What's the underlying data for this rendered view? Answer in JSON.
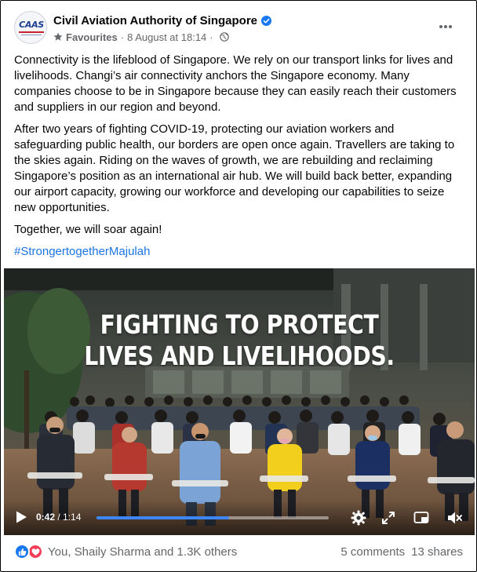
{
  "post": {
    "page_name": "Civil Aviation Authority of Singapore",
    "avatar_logo_text": "CAAS",
    "audience_label": "Favourites",
    "separator": "·",
    "timestamp": "8 August at 18:14",
    "icons": {
      "verified": "verified-badge-icon",
      "favourite": "star-icon",
      "privacy": "globe-icon",
      "more": "more-options-icon"
    }
  },
  "body": {
    "paragraphs": [
      "Connectivity is the lifeblood of Singapore. We rely on our transport links for lives and livelihoods. Changi’s air connectivity anchors the Singapore economy. Many companies choose to be in Singapore because they can easily reach their customers and suppliers in our region and beyond.",
      "After two years of fighting COVID-19, protecting our aviation workers and safeguarding public health, our borders are open once again. Travellers are taking to the skies again. Riding on the waves of growth, we are rebuilding and reclaiming Singapore’s position as an international air hub. We will build back better, expanding our airport capacity, growing our workforce and developing our capabilities to seize new opportunities.",
      "Together, we will soar again!"
    ],
    "hashtag": "#StrongertogetherMajulah"
  },
  "video": {
    "headline_line1": "FIGHTING TO PROTECT",
    "headline_line2": "LIVES AND LIVELIHOODS.",
    "current_time": "0:42",
    "time_separator": " / ",
    "duration": "1:14",
    "progress_fraction": 0.57,
    "controls": [
      "play-icon",
      "settings-gear-icon",
      "fullscreen-icon",
      "picture-in-picture-icon",
      "mute-icon"
    ]
  },
  "footer": {
    "reaction_icons": [
      "like-reaction-icon",
      "love-reaction-icon"
    ],
    "people_text": "You, Shaily Sharma and 1.3K others",
    "comments_text": "5 comments",
    "shares_text": "13 shares"
  },
  "colors": {
    "brand_blue": "#1877f2",
    "link_blue": "#1b74e4",
    "love_red": "#f33e58",
    "meta_grey": "#65676b",
    "progress_blue": "#3e86f5"
  }
}
